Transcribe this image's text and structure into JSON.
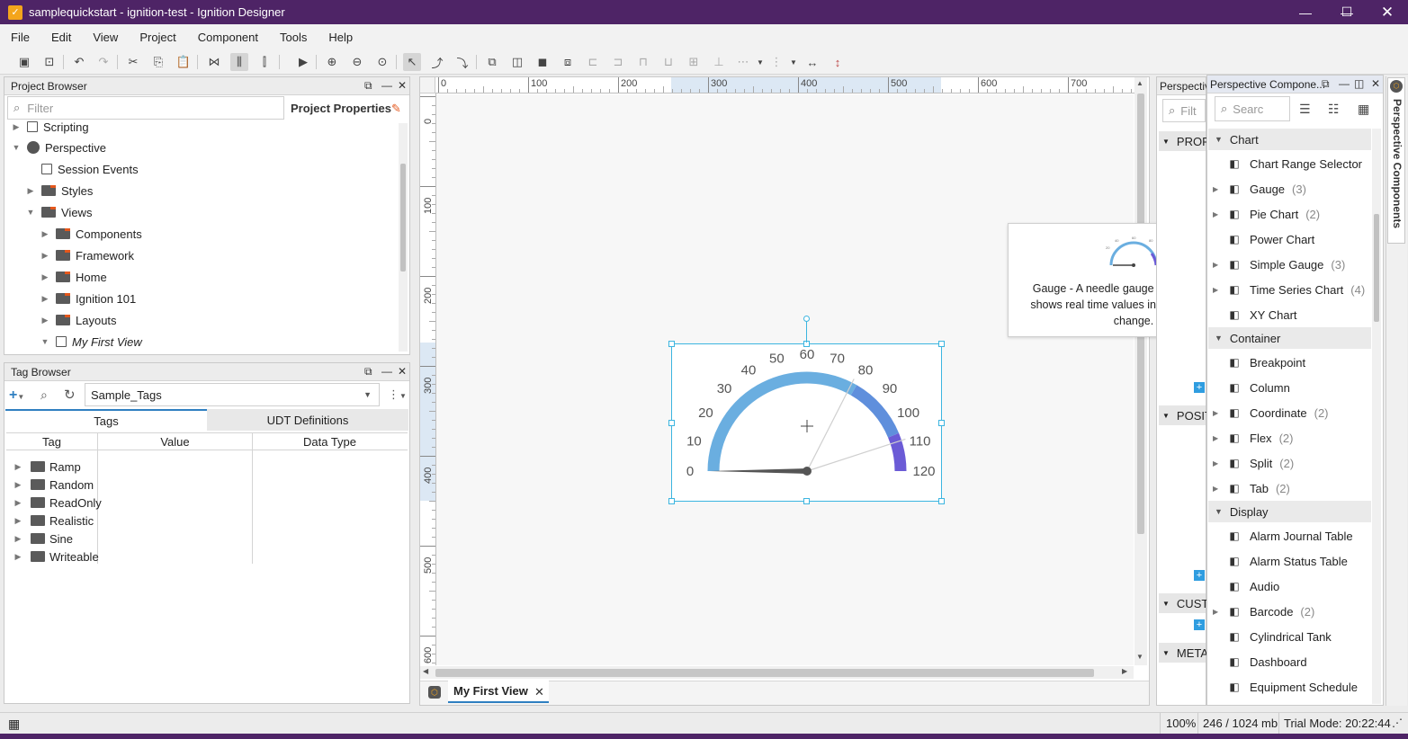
{
  "window": {
    "title": "samplequickstart - ignition-test - Ignition Designer",
    "app_icon": "ignition-logo-icon",
    "controls": [
      "minimize",
      "maximize",
      "close"
    ]
  },
  "menu": [
    {
      "label": "File"
    },
    {
      "label": "Edit"
    },
    {
      "label": "View"
    },
    {
      "label": "Project"
    },
    {
      "label": "Component"
    },
    {
      "label": "Tools"
    },
    {
      "label": "Help"
    }
  ],
  "project_browser": {
    "title": "Project Browser",
    "filter_placeholder": "Filter",
    "properties_label": "Project Properties",
    "tree": [
      {
        "label": "Scripting",
        "icon": "script-icon",
        "expanded": false
      },
      {
        "label": "Perspective",
        "icon": "perspective-icon",
        "expanded": true
      },
      {
        "label": "Session Events",
        "icon": "session-events-icon"
      },
      {
        "label": "Styles",
        "icon": "folder-icon",
        "expanded": false
      },
      {
        "label": "Views",
        "icon": "folder-icon",
        "expanded": true
      },
      {
        "label": "Components",
        "icon": "folder-icon"
      },
      {
        "label": "Framework",
        "icon": "folder-icon"
      },
      {
        "label": "Home",
        "icon": "folder-icon"
      },
      {
        "label": "Ignition 101",
        "icon": "folder-icon"
      },
      {
        "label": "Layouts",
        "icon": "folder-icon"
      },
      {
        "label": "My First View",
        "icon": "view-icon"
      }
    ]
  },
  "tag_browser": {
    "title": "Tag Browser",
    "provider": "Sample_Tags",
    "tabs": [
      "Tags",
      "UDT Definitions"
    ],
    "active_tab": "Tags",
    "columns": [
      "Tag",
      "Value",
      "Data Type"
    ],
    "rows": [
      "Ramp",
      "Random",
      "ReadOnly",
      "Realistic",
      "Sine",
      "Writeable"
    ]
  },
  "designer": {
    "ruler_h": [
      "0",
      "100",
      "200",
      "300",
      "400",
      "500",
      "600",
      "700"
    ],
    "ruler_v": [
      "0",
      "100",
      "200",
      "300",
      "400",
      "500",
      "600"
    ],
    "open_tab": "My First View",
    "gauge": {
      "ticks": [
        "0",
        "10",
        "20",
        "30",
        "40",
        "50",
        "60",
        "70",
        "80",
        "90",
        "100",
        "110",
        "120"
      ],
      "min": 0,
      "max": 120,
      "value": 0,
      "arc_color": "#6aaee0",
      "high_color": "#6b5bd6"
    }
  },
  "tooltip": {
    "text": "Gauge - A needle gauge component that shows real time values in a range as they change."
  },
  "property_editor": {
    "title": "Perspectiv",
    "filter_placeholder": "Filt",
    "sections": [
      "PROP",
      "POSIT",
      "CUST",
      "META"
    ]
  },
  "components_panel": {
    "title": "Perspective Compone...",
    "search_placeholder": "Searc",
    "side_tab": "Perspective Components",
    "categories": [
      {
        "name": "Chart",
        "items": [
          {
            "label": "Chart Range Selector",
            "icon": "chart-range-icon",
            "count": ""
          },
          {
            "label": "Gauge",
            "icon": "gauge-icon",
            "count": "(3)"
          },
          {
            "label": "Pie Chart",
            "icon": "pie-chart-icon",
            "count": "(2)"
          },
          {
            "label": "Power Chart",
            "icon": "power-chart-icon",
            "count": ""
          },
          {
            "label": "Simple Gauge",
            "icon": "simple-gauge-icon",
            "count": "(3)"
          },
          {
            "label": "Time Series Chart",
            "icon": "timeseries-icon",
            "count": "(4)"
          },
          {
            "label": "XY Chart",
            "icon": "xy-chart-icon",
            "count": ""
          }
        ]
      },
      {
        "name": "Container",
        "items": [
          {
            "label": "Breakpoint",
            "icon": "breakpoint-icon",
            "count": ""
          },
          {
            "label": "Column",
            "icon": "column-icon",
            "count": ""
          },
          {
            "label": "Coordinate",
            "icon": "coordinate-icon",
            "count": "(2)"
          },
          {
            "label": "Flex",
            "icon": "flex-icon",
            "count": "(2)"
          },
          {
            "label": "Split",
            "icon": "split-icon",
            "count": "(2)"
          },
          {
            "label": "Tab",
            "icon": "tab-icon",
            "count": "(2)"
          }
        ]
      },
      {
        "name": "Display",
        "items": [
          {
            "label": "Alarm Journal Table",
            "icon": "alarm-journal-icon",
            "count": ""
          },
          {
            "label": "Alarm Status Table",
            "icon": "alarm-status-icon",
            "count": ""
          },
          {
            "label": "Audio",
            "icon": "audio-icon",
            "count": ""
          },
          {
            "label": "Barcode",
            "icon": "barcode-icon",
            "count": "(2)"
          },
          {
            "label": "Cylindrical Tank",
            "icon": "tank-icon",
            "count": ""
          },
          {
            "label": "Dashboard",
            "icon": "dashboard-icon",
            "count": ""
          },
          {
            "label": "Equipment Schedule",
            "icon": "schedule-icon",
            "count": ""
          }
        ]
      }
    ]
  },
  "status": {
    "zoom": "100%",
    "memory": "246 / 1024 mb",
    "trial": "Trial Mode: 20:22:44"
  }
}
